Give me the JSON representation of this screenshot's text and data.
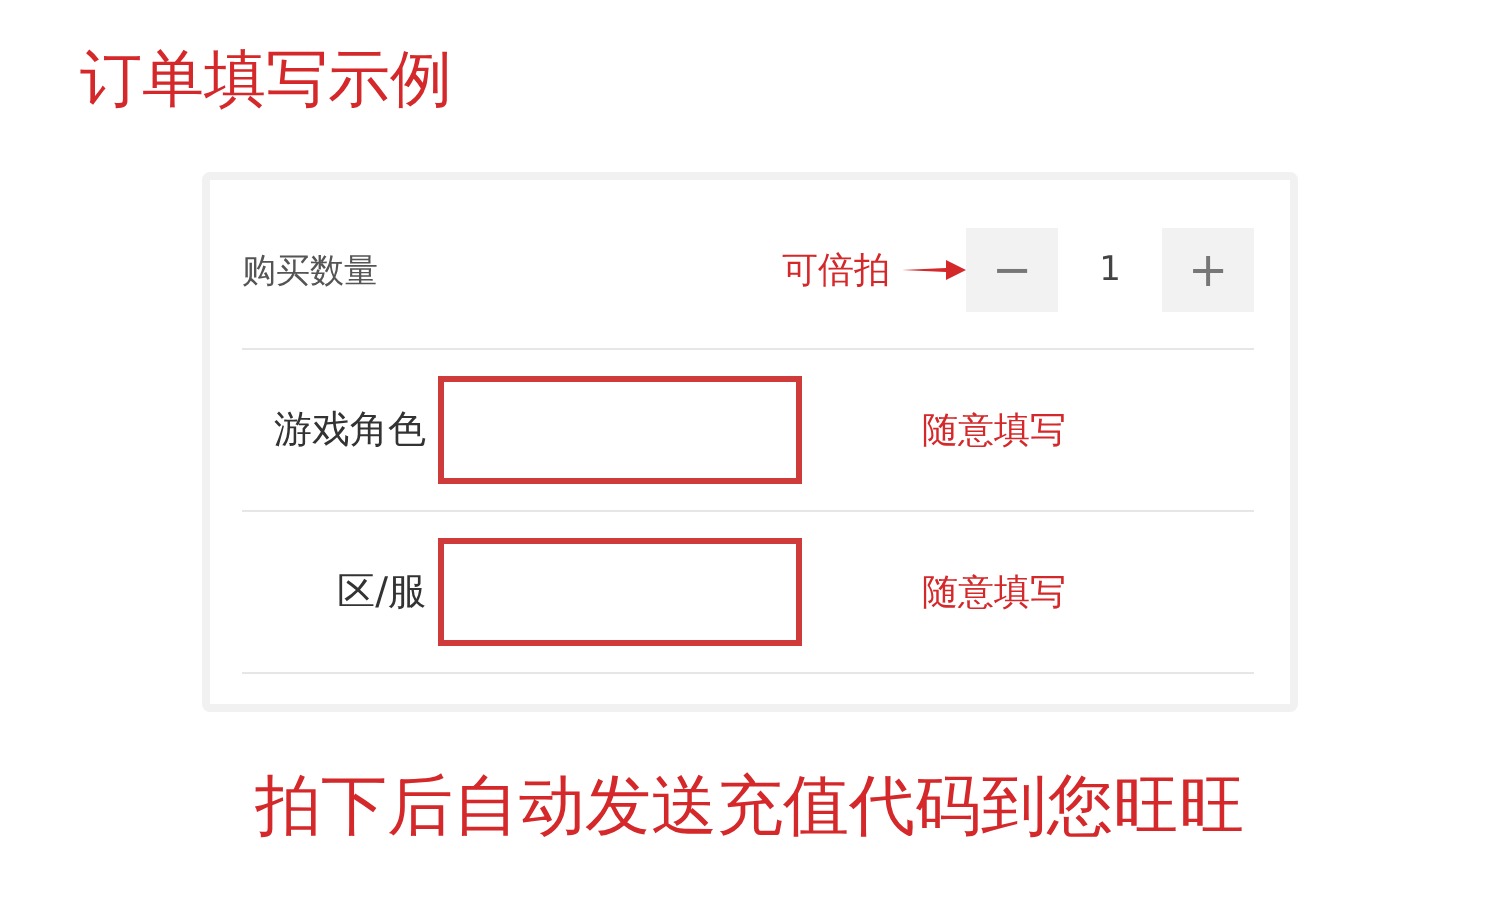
{
  "title": "订单填写示例",
  "quantity": {
    "label": "购买数量",
    "note": "可倍拍",
    "decrement": "−",
    "value": "1",
    "increment": "+"
  },
  "fields": [
    {
      "label": "游戏角色",
      "hint": "随意填写"
    },
    {
      "label": "区/服",
      "hint": "随意填写"
    }
  ],
  "footer": "拍下后自动发送充值代码到您旺旺"
}
